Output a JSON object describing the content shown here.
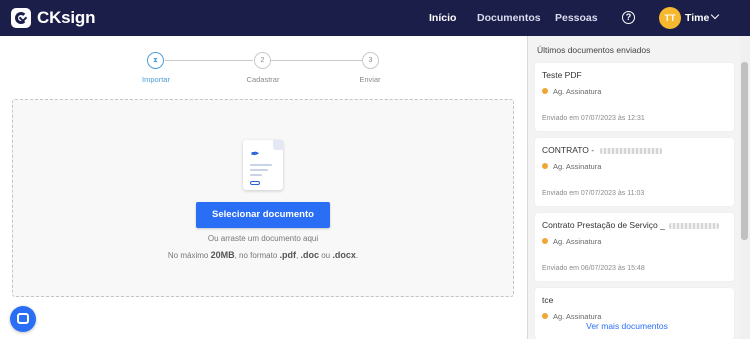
{
  "brand": {
    "name": "CKsign"
  },
  "nav": {
    "items": [
      {
        "label": "Início"
      },
      {
        "label": "Documentos"
      },
      {
        "label": "Pessoas"
      }
    ],
    "help_symbol": "?",
    "user": {
      "initials": "TT",
      "name": "Time"
    }
  },
  "stepper": {
    "steps": [
      {
        "number": "1",
        "label": "Importar",
        "state": "active"
      },
      {
        "number": "2",
        "label": "Cadastrar",
        "state": "pending"
      },
      {
        "number": "3",
        "label": "Enviar",
        "state": "pending"
      }
    ]
  },
  "upload": {
    "button_label": "Selecionar documento",
    "hint_drag": "Ou arraste um documento aqui",
    "hint_limit_prefix": "No máximo ",
    "max_size": "20MB",
    "hint_format_prefix": ", no formato ",
    "fmt_pdf": ".pdf",
    "sep1": ", ",
    "fmt_doc": ".doc",
    "sep2": " ou ",
    "fmt_docx": ".docx",
    "end": "."
  },
  "recent": {
    "title": "Últimos documentos enviados",
    "items": [
      {
        "title": "Teste PDF",
        "status": "Ag. Assinatura",
        "date": "Enviado em 07/07/2023 às 12:31"
      },
      {
        "title": "CONTRATO - ",
        "status": "Ag. Assinatura",
        "date": "Enviado em 07/07/2023 às 11:03"
      },
      {
        "title": "Contrato Prestação de Serviço _",
        "status": "Ag. Assinatura",
        "date": "Enviado em 06/07/2023 às 15:48"
      },
      {
        "title": "tce",
        "status": "Ag. Assinatura",
        "date": ""
      }
    ],
    "see_more": "Ver mais documentos"
  },
  "colors": {
    "header_bg": "#1c1e4a",
    "primary": "#2a6ef5",
    "step_active": "#4ea0d8",
    "status_pending": "#f0a534",
    "avatar": "#f5b82e"
  }
}
